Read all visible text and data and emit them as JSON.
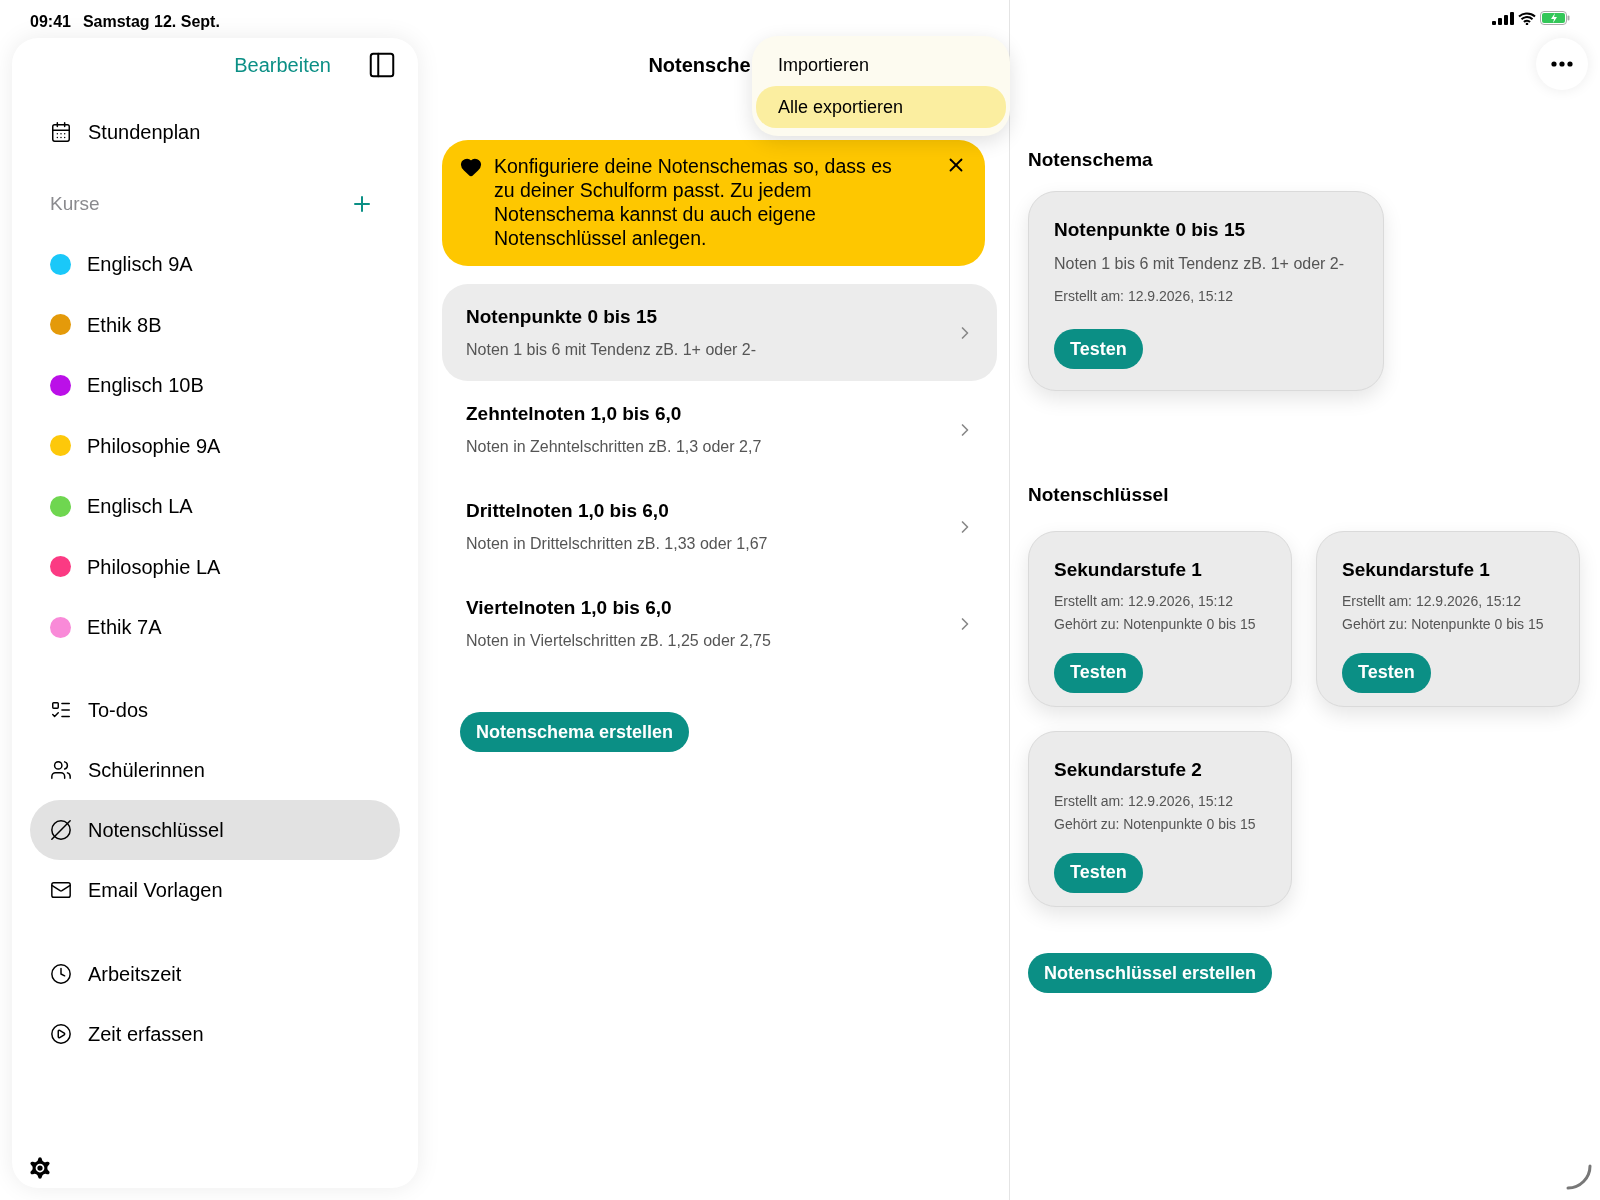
{
  "status_bar": {
    "time": "09:41",
    "date": "Samstag 12. Sept."
  },
  "sidebar": {
    "edit_label": "Bearbeiten",
    "top_items": [
      {
        "label": "Stundenplan",
        "selected": false
      }
    ],
    "courses": {
      "title": "Kurse",
      "items": [
        {
          "label": "Englisch 9A",
          "color": "#1ac8f9"
        },
        {
          "label": "Ethik 8B",
          "color": "#e49a0a"
        },
        {
          "label": "Englisch 10B",
          "color": "#bb10e8"
        },
        {
          "label": "Philosophie 9A",
          "color": "#fdc80a"
        },
        {
          "label": "Englisch LA",
          "color": "#6fd650"
        },
        {
          "label": "Philosophie LA",
          "color": "#fb3a83"
        },
        {
          "label": "Ethik 7A",
          "color": "#f98ad8"
        }
      ]
    },
    "main_items": [
      {
        "label": "To-dos",
        "selected": false
      },
      {
        "label": "Schülerinnen",
        "selected": false
      },
      {
        "label": "Notenschlüssel",
        "selected": true
      },
      {
        "label": "Email Vorlagen",
        "selected": false
      }
    ],
    "time_items": [
      {
        "label": "Arbeitszeit",
        "selected": false
      },
      {
        "label": "Zeit erfassen",
        "selected": false
      }
    ]
  },
  "middle": {
    "title": "Notensche",
    "menu": [
      {
        "label": "Importieren",
        "selected": false
      },
      {
        "label": "Alle exportieren",
        "selected": true
      }
    ],
    "banner": "Konfiguriere deine Notenschemas so, dass es zu deiner Schulform passt. Zu jedem Notenschema kannst du auch eigene Notenschlüssel anlegen.",
    "schemes": [
      {
        "title": "Notenpunkte 0 bis 15",
        "subtitle": "Noten 1 bis 6 mit Tendenz zB. 1+ oder 2-",
        "selected": true
      },
      {
        "title": "Zehntelnoten 1,0 bis 6,0",
        "subtitle": "Noten in Zehntelschritten zB. 1,3 oder 2,7",
        "selected": false
      },
      {
        "title": "Drittelnoten 1,0 bis 6,0",
        "subtitle": "Noten in Drittelschritten zB. 1,33 oder 1,67",
        "selected": false
      },
      {
        "title": "Viertelnoten 1,0 bis 6,0",
        "subtitle": "Noten in Viertelschritten zB. 1,25 oder 2,75",
        "selected": false
      }
    ],
    "create_button": "Notenschema erstellen"
  },
  "detail": {
    "schema_heading": "Notenschema",
    "schema_card": {
      "title": "Notenpunkte 0 bis 15",
      "subtitle": "Noten 1 bis 6 mit Tendenz zB. 1+ oder 2-",
      "created": "Erstellt am: 12.9.2026, 15:12",
      "button": "Testen"
    },
    "keys_heading": "Notenschlüssel",
    "key_cards": [
      {
        "title": "Sekundarstufe 1",
        "created": "Erstellt am: 12.9.2026, 15:12",
        "belongs": "Gehört zu: Notenpunkte 0 bis 15",
        "button": "Testen"
      },
      {
        "title": "Sekundarstufe 1",
        "created": "Erstellt am: 12.9.2026, 15:12",
        "belongs": "Gehört zu: Notenpunkte 0 bis 15",
        "button": "Testen"
      },
      {
        "title": "Sekundarstufe 2",
        "created": "Erstellt am: 12.9.2026, 15:12",
        "belongs": "Gehört zu: Notenpunkte 0 bis 15",
        "button": "Testen"
      }
    ],
    "create_button": "Notenschlüssel erstellen"
  }
}
